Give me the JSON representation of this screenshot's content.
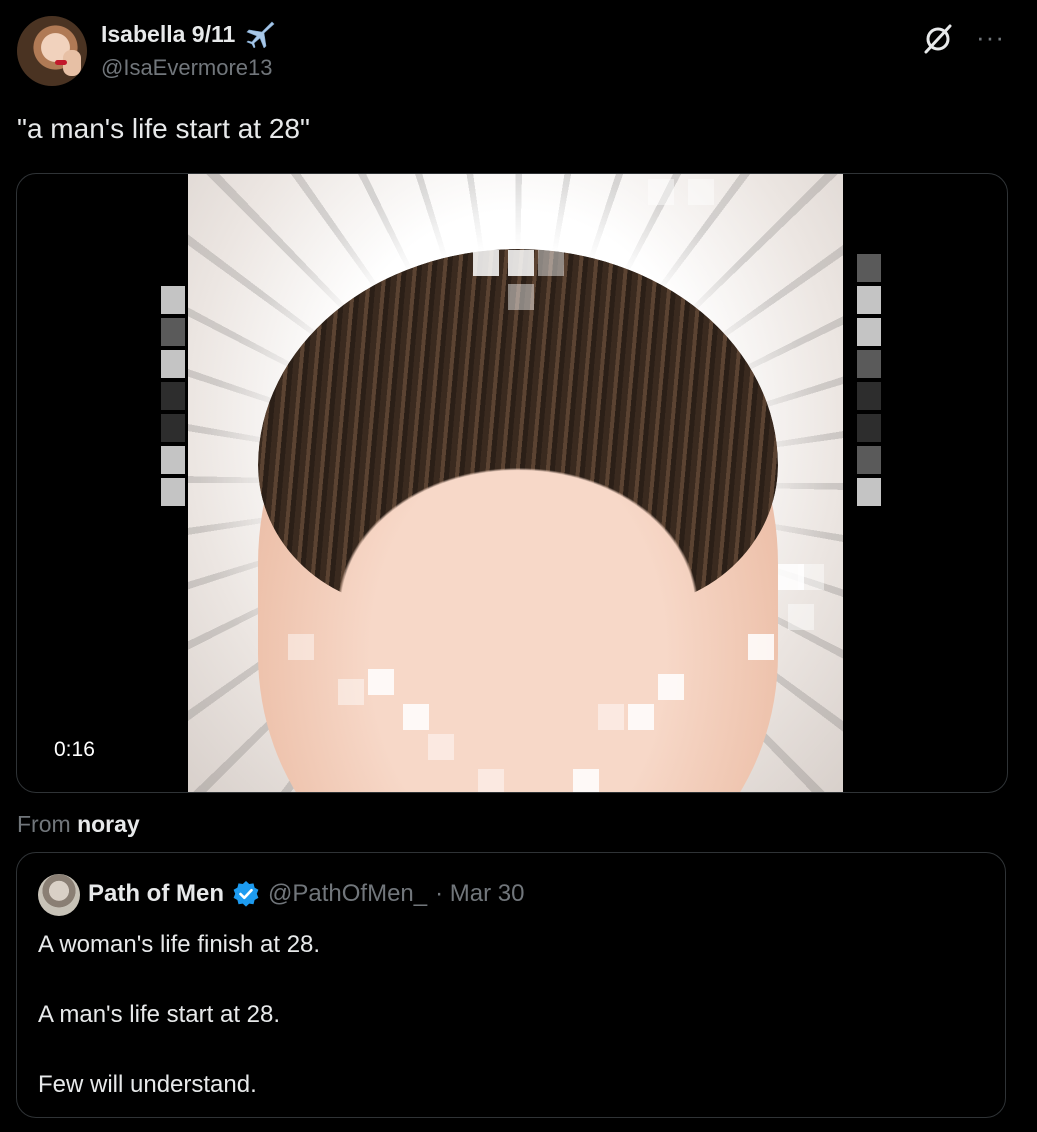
{
  "author": {
    "display_name": "Isabella 9/11",
    "handle": "@IsaEvermore13"
  },
  "icons": {
    "name_emoji": "airplane-icon",
    "grok": "grok-icon",
    "more": "more-icon"
  },
  "tweet": {
    "text": "\"a man's life start at 28\""
  },
  "media": {
    "duration": "0:16"
  },
  "attribution": {
    "prefix": "From",
    "source": "noray"
  },
  "quoted": {
    "display_name": "Path of Men",
    "handle": "@PathOfMen_",
    "date": "· Mar 30",
    "verified_color": "#1d9bf0",
    "lines": [
      "A woman's life finish at 28.",
      "A man's life start at 28.",
      "Few will understand."
    ]
  },
  "colors": {
    "background": "#000000",
    "text_primary": "#e7e9ea",
    "text_secondary": "#71767b",
    "border": "#2f3336"
  },
  "more_glyph": "···"
}
